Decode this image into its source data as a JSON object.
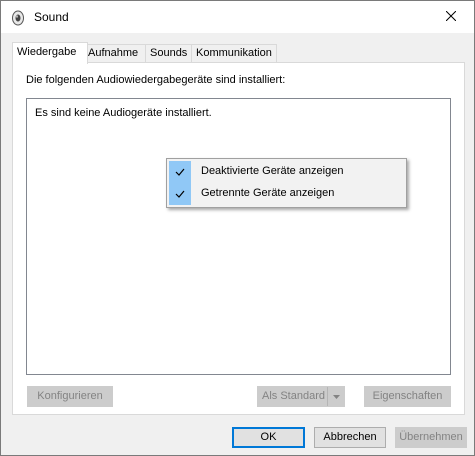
{
  "window": {
    "title": "Sound"
  },
  "icons": {
    "app": "speaker-icon",
    "close": "close-icon",
    "check": "checkmark-icon",
    "arrow": "chevron-down-icon"
  },
  "tabs": [
    {
      "label": "Wiedergabe",
      "active": true
    },
    {
      "label": "Aufnahme",
      "active": false
    },
    {
      "label": "Sounds",
      "active": false
    },
    {
      "label": "Kommunikation",
      "active": false
    }
  ],
  "panel": {
    "description": "Die folgenden Audiowiedergabegeräte sind installiert:",
    "empty_message": "Es sind keine Audiogeräte installiert."
  },
  "context_menu": {
    "items": [
      {
        "label": "Deaktivierte Geräte anzeigen",
        "checked": true
      },
      {
        "label": "Getrennte Geräte anzeigen",
        "checked": true
      }
    ]
  },
  "panel_buttons": {
    "configure": "Konfigurieren",
    "set_default": "Als Standard",
    "properties": "Eigenschaften"
  },
  "dialog_buttons": {
    "ok": "OK",
    "cancel": "Abbrechen",
    "apply": "Übernehmen"
  },
  "colors": {
    "menu_check_highlight": "#90c8f6",
    "focus_border": "#0078d7"
  }
}
